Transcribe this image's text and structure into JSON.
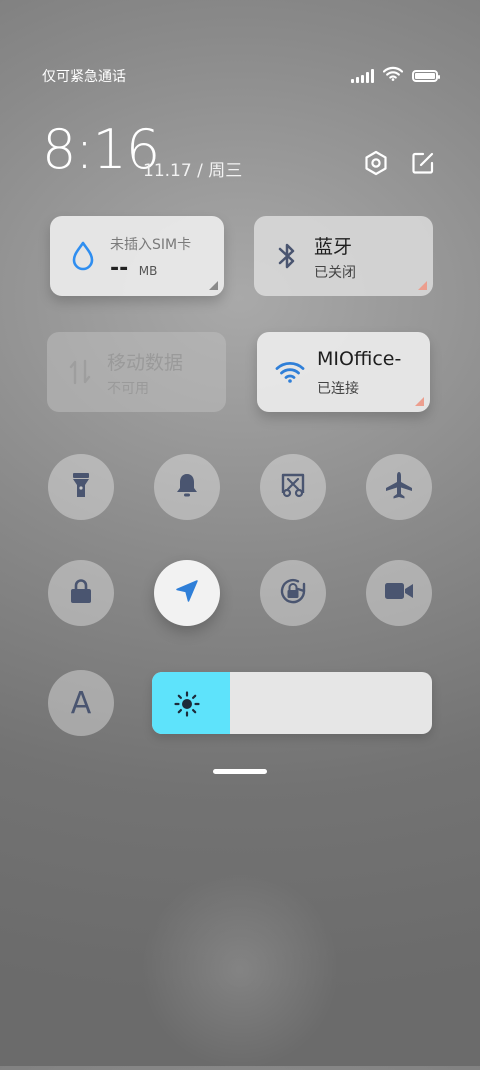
{
  "status": {
    "carrier_text": "仅可紧急通话"
  },
  "header": {
    "time": "8:16",
    "date": "11.17 / 周三"
  },
  "tiles": {
    "data_usage": {
      "title": "未插入SIM卡",
      "value": "--",
      "unit": "MB"
    },
    "bluetooth": {
      "title": "蓝牙",
      "status": "已关闭"
    },
    "mobile_data": {
      "title": "移动数据",
      "status": "不可用"
    },
    "wifi": {
      "title": "MIOffice-",
      "status": "已连接"
    }
  },
  "toggles": [
    {
      "name": "flashlight-icon",
      "active": false
    },
    {
      "name": "bell-icon",
      "active": false
    },
    {
      "name": "screenshot-icon",
      "active": false
    },
    {
      "name": "airplane-icon",
      "active": false
    },
    {
      "name": "lock-icon",
      "active": false
    },
    {
      "name": "location-icon",
      "active": true
    },
    {
      "name": "rotation-lock-icon",
      "active": false
    },
    {
      "name": "video-camera-icon",
      "active": false
    }
  ],
  "reading_mode": {
    "label": "A"
  },
  "brightness": {
    "level": 0.28
  },
  "colors": {
    "accent": "#2f7fd8",
    "brightness_fill": "#5ee3fb",
    "icon_gray": "#4a5570"
  }
}
